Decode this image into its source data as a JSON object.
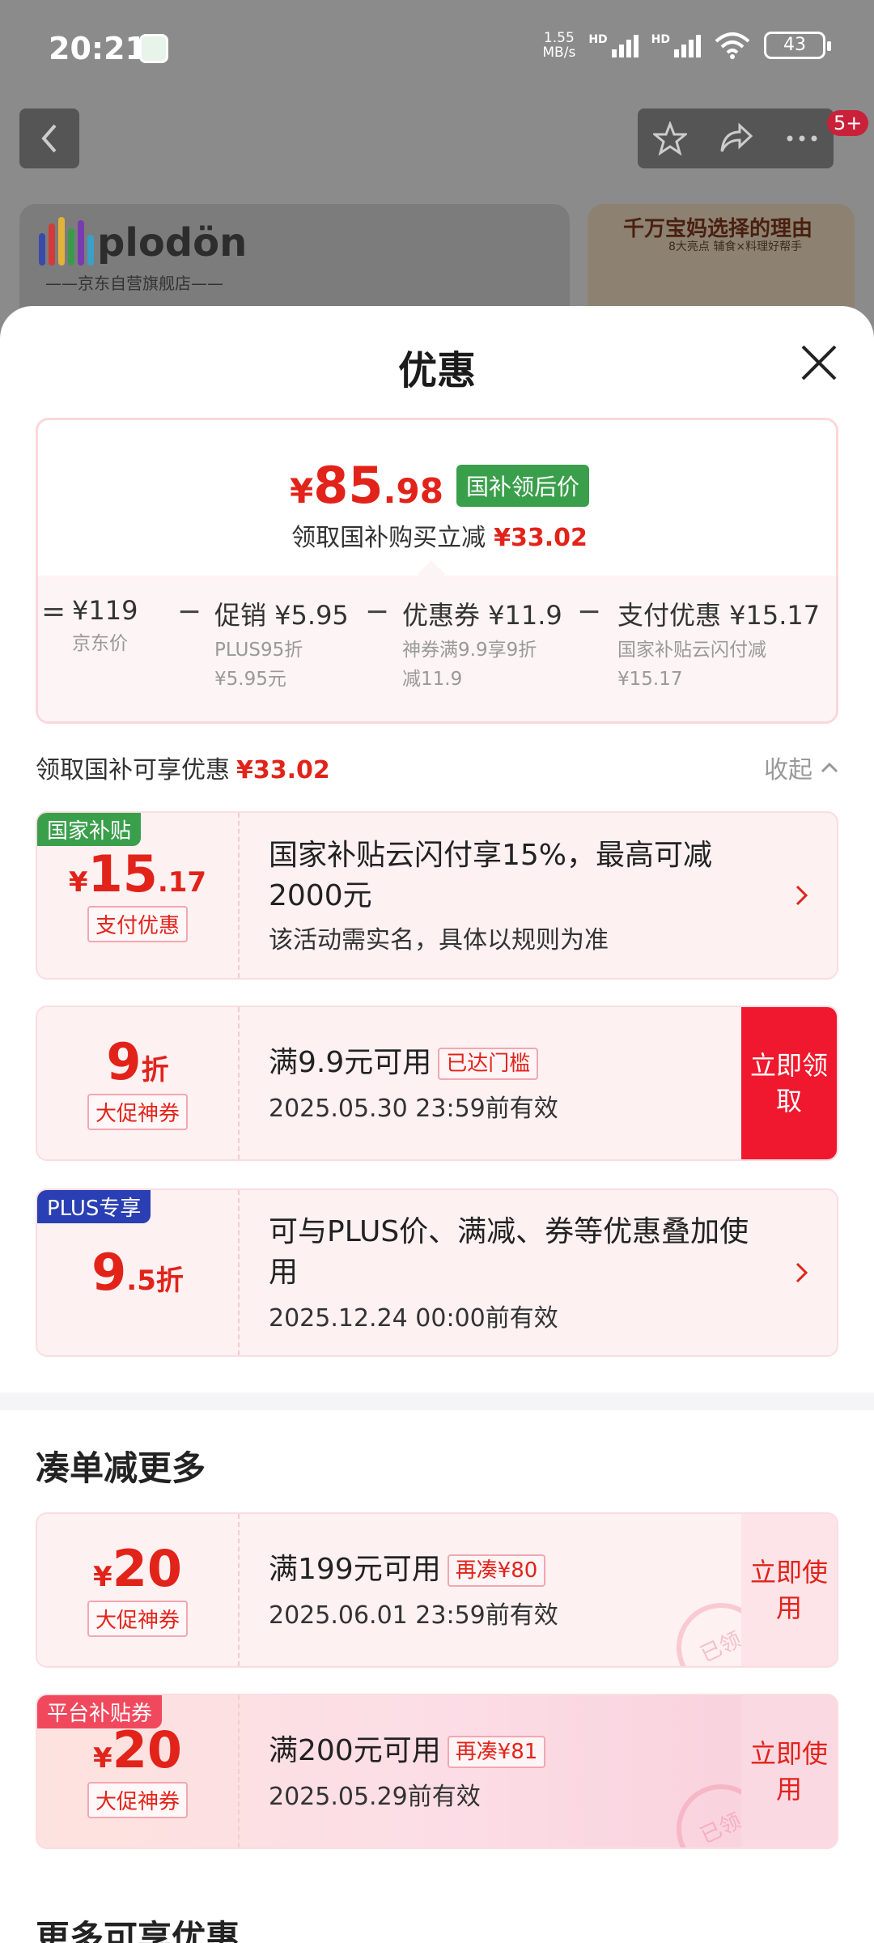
{
  "status_bar": {
    "time": "20:21",
    "net_speed_value": "1.55",
    "net_speed_unit": "MB/s",
    "hd1": "HD",
    "hd2": "HD",
    "battery": "43"
  },
  "nav": {
    "badge": "5+"
  },
  "product_banner": {
    "brand_name": "plodön",
    "brand_sub": "——京东自营旗舰店——",
    "promo_title": "千万宝妈选择的理由",
    "promo_sub": "8大亮点 辅食×料理好帮手"
  },
  "sheet": {
    "title": "优惠"
  },
  "summary": {
    "price_yen": "¥",
    "price_int": "85",
    "price_dec": ".98",
    "price_tag": "国补领后价",
    "sub_text": "领取国补购买立减",
    "sub_amount": "¥33.02",
    "breakdown": [
      {
        "main": "¥119",
        "sub1": "京东价",
        "sub2": ""
      },
      {
        "main": "促销 ¥5.95",
        "sub1": "PLUS95折",
        "sub2": "¥5.95元"
      },
      {
        "main": "优惠券 ¥11.9",
        "sub1": "神券满9.9享9折",
        "sub2": "减11.9"
      },
      {
        "main": "支付优惠 ¥15.17",
        "sub1": "国家补贴云闪付减",
        "sub2": "¥15.17"
      }
    ],
    "op_equal": "=",
    "op_minus": "−"
  },
  "available": {
    "label": "领取国补可享优惠",
    "amount": "¥33.02",
    "collapse": "收起"
  },
  "coupons": [
    {
      "corner": "国家补贴",
      "yen": "¥",
      "int": "15",
      "dec": ".17",
      "kind": "支付优惠",
      "title": "国家补贴云闪付享15%，最高可减2000元",
      "desc": "该活动需实名，具体以规则为准"
    },
    {
      "int": "9",
      "suffix": "折",
      "kind": "大促神券",
      "title": "满9.9元可用",
      "chip": "已达门槛",
      "date": "2025.05.30 23:59前有效",
      "button": "立即领取"
    },
    {
      "corner": "PLUS专享",
      "int": "9",
      "dec": ".5",
      "suffix": "折",
      "title": "可与PLUS价、满减、券等优惠叠加使用",
      "date": "2025.12.24 00:00前有效"
    }
  ],
  "more_section": {
    "title": "凑单减更多",
    "coupons": [
      {
        "yen": "¥",
        "int": "20",
        "kind": "大促神券",
        "title": "满199元可用",
        "chip": "再凑¥80",
        "date": "2025.06.01 23:59前有效",
        "button": "立即使用",
        "stamp": "已领"
      },
      {
        "corner": "平台补贴券",
        "yen": "¥",
        "int": "20",
        "kind": "大促神券",
        "title": "满200元可用",
        "chip": "再凑¥81",
        "date": "2025.05.29前有效",
        "button": "立即使用",
        "stamp": "已领"
      }
    ]
  },
  "more_available_title": "更多可享优惠",
  "colors": {
    "accent_red": "#e2231a",
    "green_tag": "#3a9f4b",
    "plus_blue": "#2a3fb3",
    "button_red": "#f0182e"
  }
}
